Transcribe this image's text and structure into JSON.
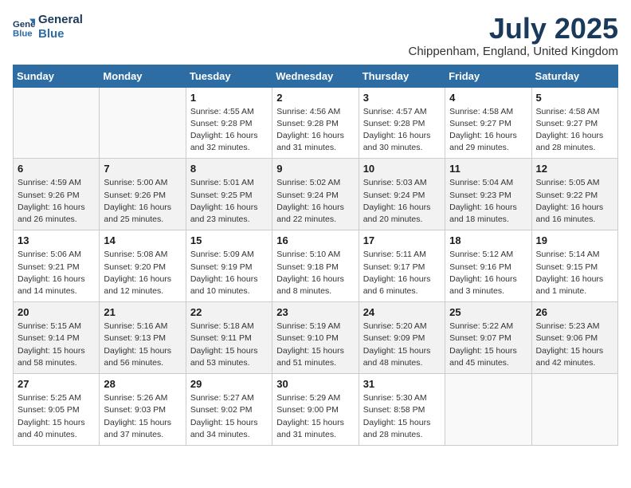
{
  "logo": {
    "text_line1": "General",
    "text_line2": "Blue"
  },
  "header": {
    "month_year": "July 2025",
    "location": "Chippenham, England, United Kingdom"
  },
  "weekdays": [
    "Sunday",
    "Monday",
    "Tuesday",
    "Wednesday",
    "Thursday",
    "Friday",
    "Saturday"
  ],
  "weeks": [
    [
      {
        "day": "",
        "info": ""
      },
      {
        "day": "",
        "info": ""
      },
      {
        "day": "1",
        "info": "Sunrise: 4:55 AM\nSunset: 9:28 PM\nDaylight: 16 hours\nand 32 minutes."
      },
      {
        "day": "2",
        "info": "Sunrise: 4:56 AM\nSunset: 9:28 PM\nDaylight: 16 hours\nand 31 minutes."
      },
      {
        "day": "3",
        "info": "Sunrise: 4:57 AM\nSunset: 9:28 PM\nDaylight: 16 hours\nand 30 minutes."
      },
      {
        "day": "4",
        "info": "Sunrise: 4:58 AM\nSunset: 9:27 PM\nDaylight: 16 hours\nand 29 minutes."
      },
      {
        "day": "5",
        "info": "Sunrise: 4:58 AM\nSunset: 9:27 PM\nDaylight: 16 hours\nand 28 minutes."
      }
    ],
    [
      {
        "day": "6",
        "info": "Sunrise: 4:59 AM\nSunset: 9:26 PM\nDaylight: 16 hours\nand 26 minutes."
      },
      {
        "day": "7",
        "info": "Sunrise: 5:00 AM\nSunset: 9:26 PM\nDaylight: 16 hours\nand 25 minutes."
      },
      {
        "day": "8",
        "info": "Sunrise: 5:01 AM\nSunset: 9:25 PM\nDaylight: 16 hours\nand 23 minutes."
      },
      {
        "day": "9",
        "info": "Sunrise: 5:02 AM\nSunset: 9:24 PM\nDaylight: 16 hours\nand 22 minutes."
      },
      {
        "day": "10",
        "info": "Sunrise: 5:03 AM\nSunset: 9:24 PM\nDaylight: 16 hours\nand 20 minutes."
      },
      {
        "day": "11",
        "info": "Sunrise: 5:04 AM\nSunset: 9:23 PM\nDaylight: 16 hours\nand 18 minutes."
      },
      {
        "day": "12",
        "info": "Sunrise: 5:05 AM\nSunset: 9:22 PM\nDaylight: 16 hours\nand 16 minutes."
      }
    ],
    [
      {
        "day": "13",
        "info": "Sunrise: 5:06 AM\nSunset: 9:21 PM\nDaylight: 16 hours\nand 14 minutes."
      },
      {
        "day": "14",
        "info": "Sunrise: 5:08 AM\nSunset: 9:20 PM\nDaylight: 16 hours\nand 12 minutes."
      },
      {
        "day": "15",
        "info": "Sunrise: 5:09 AM\nSunset: 9:19 PM\nDaylight: 16 hours\nand 10 minutes."
      },
      {
        "day": "16",
        "info": "Sunrise: 5:10 AM\nSunset: 9:18 PM\nDaylight: 16 hours\nand 8 minutes."
      },
      {
        "day": "17",
        "info": "Sunrise: 5:11 AM\nSunset: 9:17 PM\nDaylight: 16 hours\nand 6 minutes."
      },
      {
        "day": "18",
        "info": "Sunrise: 5:12 AM\nSunset: 9:16 PM\nDaylight: 16 hours\nand 3 minutes."
      },
      {
        "day": "19",
        "info": "Sunrise: 5:14 AM\nSunset: 9:15 PM\nDaylight: 16 hours\nand 1 minute."
      }
    ],
    [
      {
        "day": "20",
        "info": "Sunrise: 5:15 AM\nSunset: 9:14 PM\nDaylight: 15 hours\nand 58 minutes."
      },
      {
        "day": "21",
        "info": "Sunrise: 5:16 AM\nSunset: 9:13 PM\nDaylight: 15 hours\nand 56 minutes."
      },
      {
        "day": "22",
        "info": "Sunrise: 5:18 AM\nSunset: 9:11 PM\nDaylight: 15 hours\nand 53 minutes."
      },
      {
        "day": "23",
        "info": "Sunrise: 5:19 AM\nSunset: 9:10 PM\nDaylight: 15 hours\nand 51 minutes."
      },
      {
        "day": "24",
        "info": "Sunrise: 5:20 AM\nSunset: 9:09 PM\nDaylight: 15 hours\nand 48 minutes."
      },
      {
        "day": "25",
        "info": "Sunrise: 5:22 AM\nSunset: 9:07 PM\nDaylight: 15 hours\nand 45 minutes."
      },
      {
        "day": "26",
        "info": "Sunrise: 5:23 AM\nSunset: 9:06 PM\nDaylight: 15 hours\nand 42 minutes."
      }
    ],
    [
      {
        "day": "27",
        "info": "Sunrise: 5:25 AM\nSunset: 9:05 PM\nDaylight: 15 hours\nand 40 minutes."
      },
      {
        "day": "28",
        "info": "Sunrise: 5:26 AM\nSunset: 9:03 PM\nDaylight: 15 hours\nand 37 minutes."
      },
      {
        "day": "29",
        "info": "Sunrise: 5:27 AM\nSunset: 9:02 PM\nDaylight: 15 hours\nand 34 minutes."
      },
      {
        "day": "30",
        "info": "Sunrise: 5:29 AM\nSunset: 9:00 PM\nDaylight: 15 hours\nand 31 minutes."
      },
      {
        "day": "31",
        "info": "Sunrise: 5:30 AM\nSunset: 8:58 PM\nDaylight: 15 hours\nand 28 minutes."
      },
      {
        "day": "",
        "info": ""
      },
      {
        "day": "",
        "info": ""
      }
    ]
  ]
}
